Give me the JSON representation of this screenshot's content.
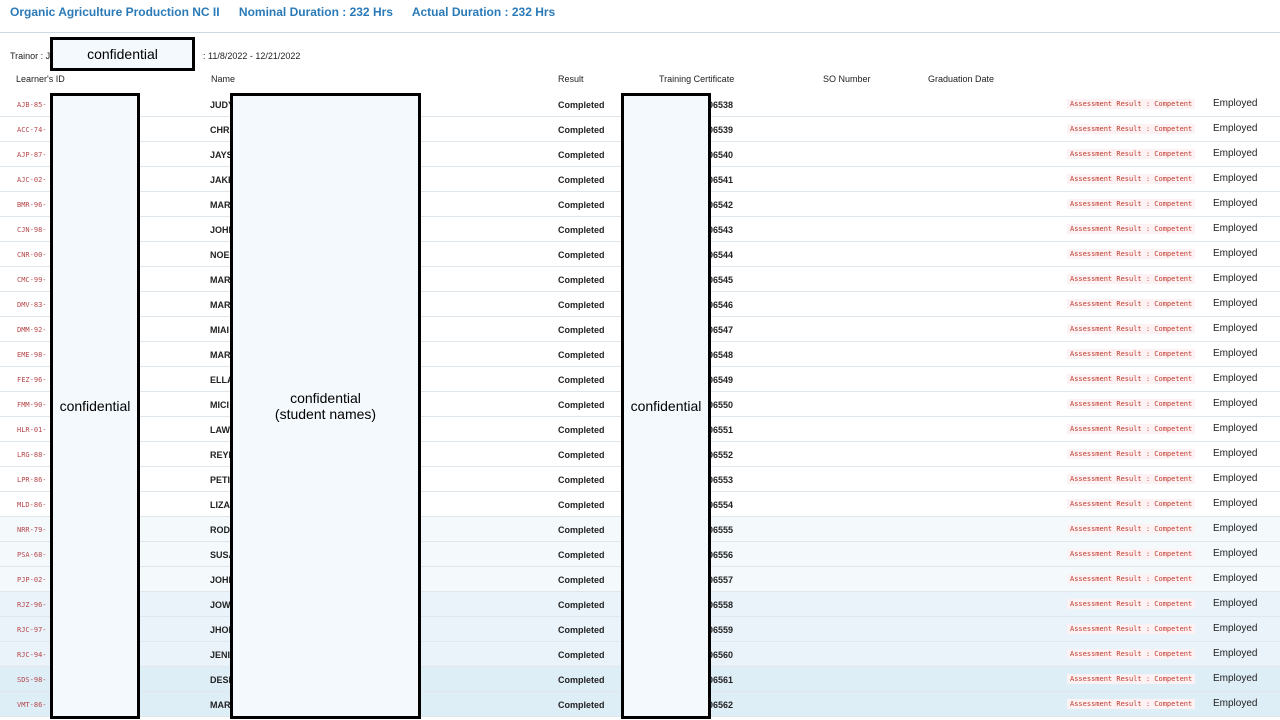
{
  "header": {
    "course": "Organic Agriculture Production NC II",
    "nominal": "Nominal Duration : 232 Hrs",
    "actual": "Actual Duration : 232 Hrs"
  },
  "trainor": {
    "label": "Trainor : J",
    "dates": ": 11/8/2022 - 12/21/2022"
  },
  "redactions": {
    "trainor": "confidential",
    "id": "confidential",
    "name_line1": "confidential",
    "name_line2": "(student names)",
    "cert": "confidential"
  },
  "columns": {
    "learner_id": "Learner's ID",
    "name": "Name",
    "result": "Result",
    "certificate": "Training Certificate",
    "so_number": "SO Number",
    "graduation": "Graduation Date"
  },
  "rows": [
    {
      "id": "AJB-85-",
      "name": "JUDY",
      "result": "Completed",
      "cert": "006538",
      "assessment": "Assessment Result : Competent",
      "status": "Employed"
    },
    {
      "id": "ACC-74-",
      "name": "CHRI",
      "result": "Completed",
      "cert": "006539",
      "assessment": "Assessment Result : Competent",
      "status": "Employed"
    },
    {
      "id": "AJP-87-",
      "name": "JAYS",
      "result": "Completed",
      "cert": "006540",
      "assessment": "Assessment Result : Competent",
      "status": "Employed"
    },
    {
      "id": "AJC-02-",
      "name": "JAKE",
      "result": "Completed",
      "cert": "006541",
      "assessment": "Assessment Result : Competent",
      "status": "Employed"
    },
    {
      "id": "BMR-96-",
      "name": "MAR",
      "result": "Completed",
      "cert": "006542",
      "assessment": "Assessment Result : Competent",
      "status": "Employed"
    },
    {
      "id": "CJN-98-",
      "name": "JOHI",
      "result": "Completed",
      "cert": "006543",
      "assessment": "Assessment Result : Competent",
      "status": "Employed"
    },
    {
      "id": "CNR-00-",
      "name": "NOEI",
      "result": "Completed",
      "cert": "006544",
      "assessment": "Assessment Result : Competent",
      "status": "Employed"
    },
    {
      "id": "CMC-99-",
      "name": "MAR",
      "result": "Completed",
      "cert": "006545",
      "assessment": "Assessment Result : Competent",
      "status": "Employed"
    },
    {
      "id": "DMV-83-",
      "name": "MAR",
      "result": "Completed",
      "cert": "006546",
      "assessment": "Assessment Result : Competent",
      "status": "Employed"
    },
    {
      "id": "DMM-92-",
      "name": "MIAI",
      "result": "Completed",
      "cert": "006547",
      "assessment": "Assessment Result : Competent",
      "status": "Employed"
    },
    {
      "id": "EME-98-",
      "name": "MAR",
      "result": "Completed",
      "cert": "006548",
      "assessment": "Assessment Result : Competent",
      "status": "Employed"
    },
    {
      "id": "FEZ-96-",
      "name": "ELLA",
      "result": "Completed",
      "cert": "006549",
      "assessment": "Assessment Result : Competent",
      "status": "Employed"
    },
    {
      "id": "FMM-90-",
      "name": "MICI",
      "result": "Completed",
      "cert": "006550",
      "assessment": "Assessment Result : Competent",
      "status": "Employed"
    },
    {
      "id": "HLR-01-",
      "name": "LAW",
      "result": "Completed",
      "cert": "006551",
      "assessment": "Assessment Result : Competent",
      "status": "Employed"
    },
    {
      "id": "LRG-88-",
      "name": "REYI",
      "result": "Completed",
      "cert": "006552",
      "assessment": "Assessment Result : Competent",
      "status": "Employed"
    },
    {
      "id": "LPR-86-",
      "name": "PETI",
      "result": "Completed",
      "cert": "006553",
      "assessment": "Assessment Result : Competent",
      "status": "Employed"
    },
    {
      "id": "MLD-86-",
      "name": "LIZA",
      "result": "Completed",
      "cert": "006554",
      "assessment": "Assessment Result : Competent",
      "status": "Employed"
    },
    {
      "id": "NRR-79-",
      "name": "RODI",
      "result": "Completed",
      "cert": "006555",
      "assessment": "Assessment Result : Competent",
      "status": "Employed"
    },
    {
      "id": "PSA-68-",
      "name": "SUSA",
      "result": "Completed",
      "cert": "006556",
      "assessment": "Assessment Result : Competent",
      "status": "Employed"
    },
    {
      "id": "PJP-02-",
      "name": "JOHI",
      "result": "Completed",
      "cert": "006557",
      "assessment": "Assessment Result : Competent",
      "status": "Employed"
    },
    {
      "id": "RJZ-96-",
      "name": "JOW",
      "result": "Completed",
      "cert": "006558",
      "assessment": "Assessment Result : Competent",
      "status": "Employed"
    },
    {
      "id": "RJC-97-",
      "name": "JHOI",
      "result": "Completed",
      "cert": "006559",
      "assessment": "Assessment Result : Competent",
      "status": "Employed"
    },
    {
      "id": "RJC-94-",
      "name": "JENI",
      "result": "Completed",
      "cert": "006560",
      "assessment": "Assessment Result : Competent",
      "status": "Employed"
    },
    {
      "id": "SDS-98-",
      "name": "DESI",
      "result": "Completed",
      "cert": "006561",
      "assessment": "Assessment Result : Competent",
      "status": "Employed"
    },
    {
      "id": "VMT-86-",
      "name": "MAR",
      "result": "Completed",
      "cert": "006562",
      "assessment": "Assessment Result : Competent",
      "status": "Employed"
    }
  ]
}
